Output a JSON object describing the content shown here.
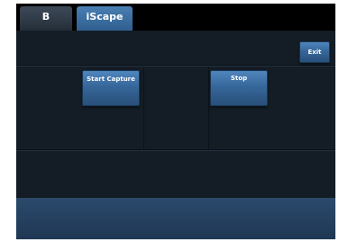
{
  "tabs": [
    {
      "label": "B",
      "active": false
    },
    {
      "label": "iScape",
      "active": true
    }
  ],
  "buttons": {
    "exit_label": "Exit",
    "start_capture_label": "Start Capture",
    "stop_label": "Stop"
  },
  "colors": {
    "background": "#141c24",
    "tabbar": "#000000",
    "active_tab": "#3f72a6",
    "button": "#3a6b9e",
    "footer": "#24405f"
  }
}
